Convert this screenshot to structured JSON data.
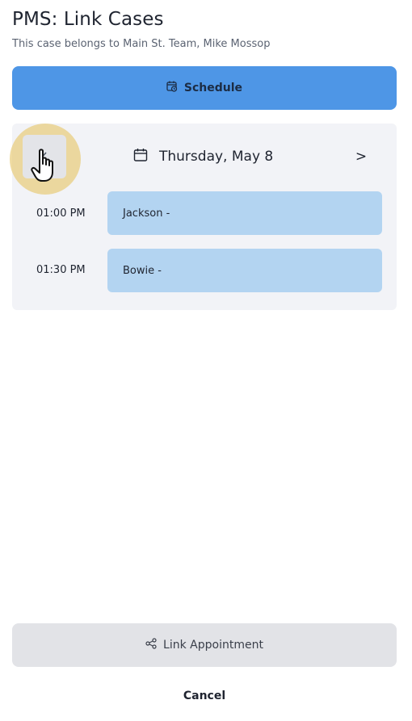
{
  "header": {
    "title": "PMS: Link Cases",
    "subtitle": "This case belongs to Main St. Team, Mike Mossop"
  },
  "schedule_button": {
    "label": "Schedule",
    "icon": "calendar-clock-icon"
  },
  "calendar": {
    "prev_icon": "chevron-left-icon",
    "next_label": ">",
    "date_label": "Thursday, May 8",
    "date_icon": "calendar-icon",
    "slots": [
      {
        "time": "01:00 PM",
        "label": "Jackson -"
      },
      {
        "time": "01:30 PM",
        "label": "Bowie -"
      }
    ]
  },
  "link_button": {
    "label": "Link Appointment",
    "icon": "share-nodes-icon"
  },
  "cancel_button": {
    "label": "Cancel"
  },
  "colors": {
    "primary": "#4e96e6",
    "slot": "#b3d4f1",
    "panel": "#f2f3f7",
    "secondary_button": "#e2e3e7",
    "click_highlight": "#e6c86e"
  }
}
